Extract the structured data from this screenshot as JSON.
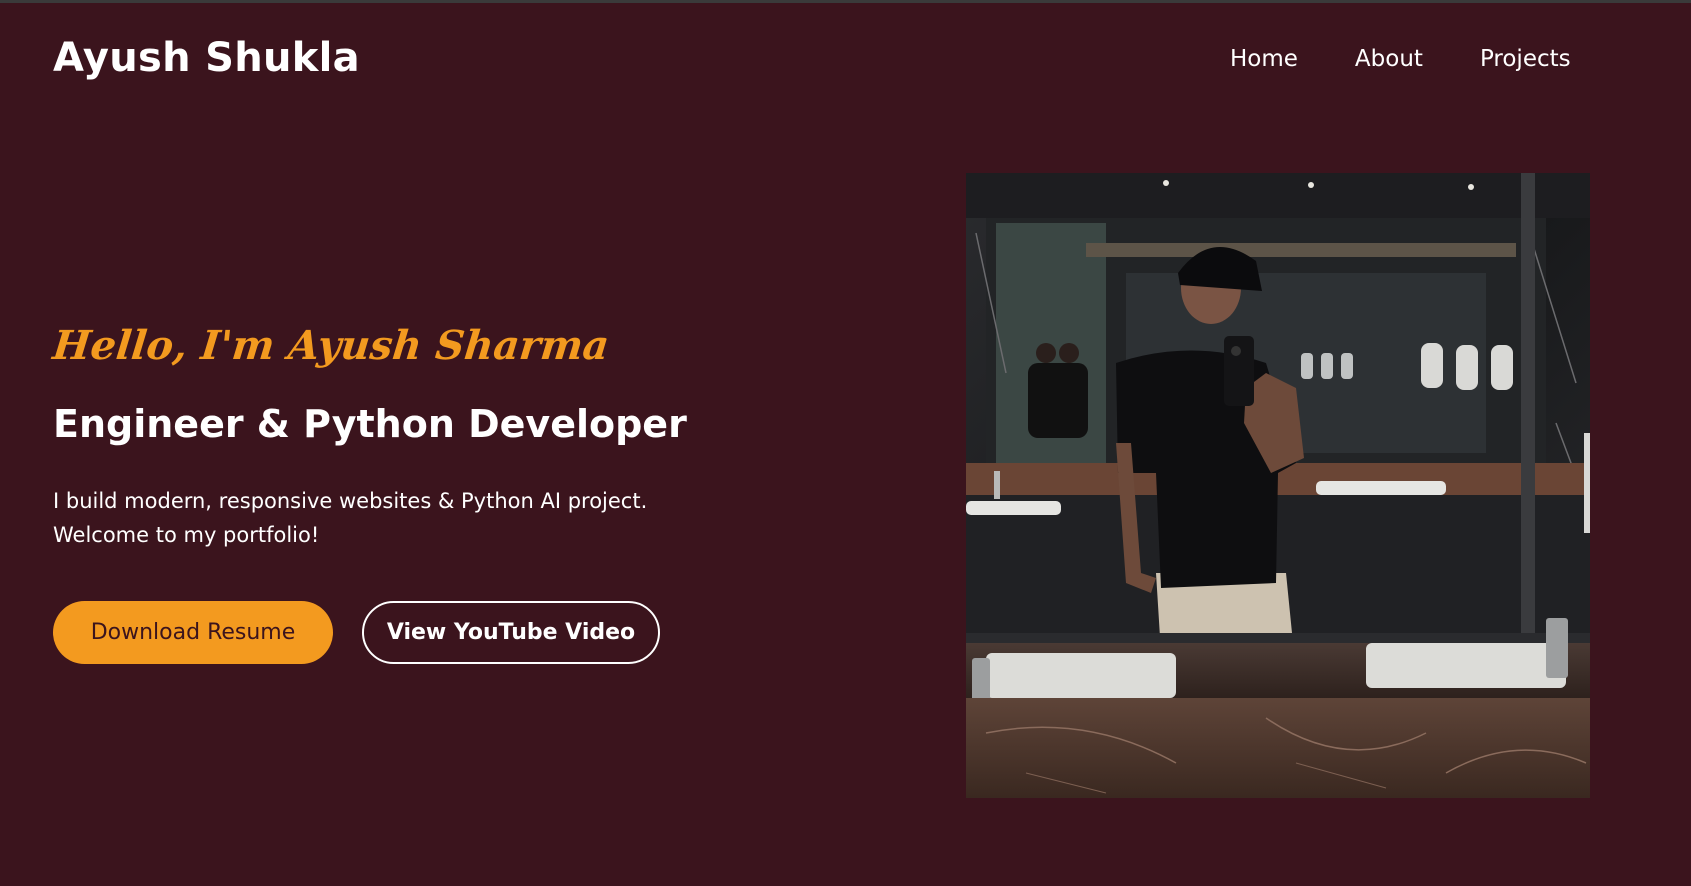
{
  "header": {
    "logo": "Ayush Shukla",
    "nav": [
      "Home",
      "About",
      "Projects"
    ]
  },
  "hero": {
    "greeting": "Hello, I'm Ayush Sharma",
    "role": "Engineer & Python Developer",
    "intro_line1": "I build modern, responsive websites & Python AI project.",
    "intro_line2": "Welcome to my portfolio!",
    "primary_button": "Download Resume",
    "secondary_button": "View YouTube Video"
  },
  "colors": {
    "background": "#3b141d",
    "accent": "#f39a1f",
    "text": "#ffffff"
  },
  "image": {
    "subject": "mirror selfie photo"
  }
}
